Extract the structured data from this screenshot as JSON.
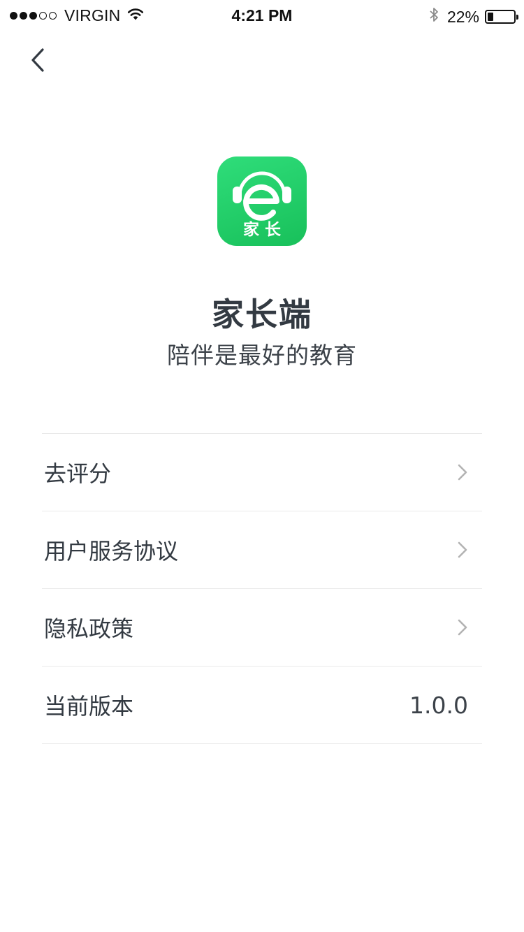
{
  "status_bar": {
    "carrier": "VIRGIN",
    "time": "4:21 PM",
    "battery_percent": "22%",
    "battery_level": 0.22,
    "signal_bars_filled": 3,
    "signal_bars_total": 5
  },
  "app": {
    "icon_text": "家 长",
    "icon_letter": "e",
    "icon_color": "#22cf68",
    "name": "家长端",
    "slogan": "陪伴是最好的教育"
  },
  "menu": {
    "items": [
      {
        "label": "去评分",
        "value": "",
        "has_chevron": true
      },
      {
        "label": "用户服务协议",
        "value": "",
        "has_chevron": true
      },
      {
        "label": "隐私政策",
        "value": "",
        "has_chevron": true
      },
      {
        "label": "当前版本",
        "value": "1.0.0",
        "has_chevron": false
      }
    ]
  },
  "icons": {
    "back": "chevron-left-icon",
    "chevron": "chevron-right-icon",
    "wifi": "wifi-icon",
    "bluetooth": "bluetooth-icon",
    "battery": "battery-icon"
  }
}
